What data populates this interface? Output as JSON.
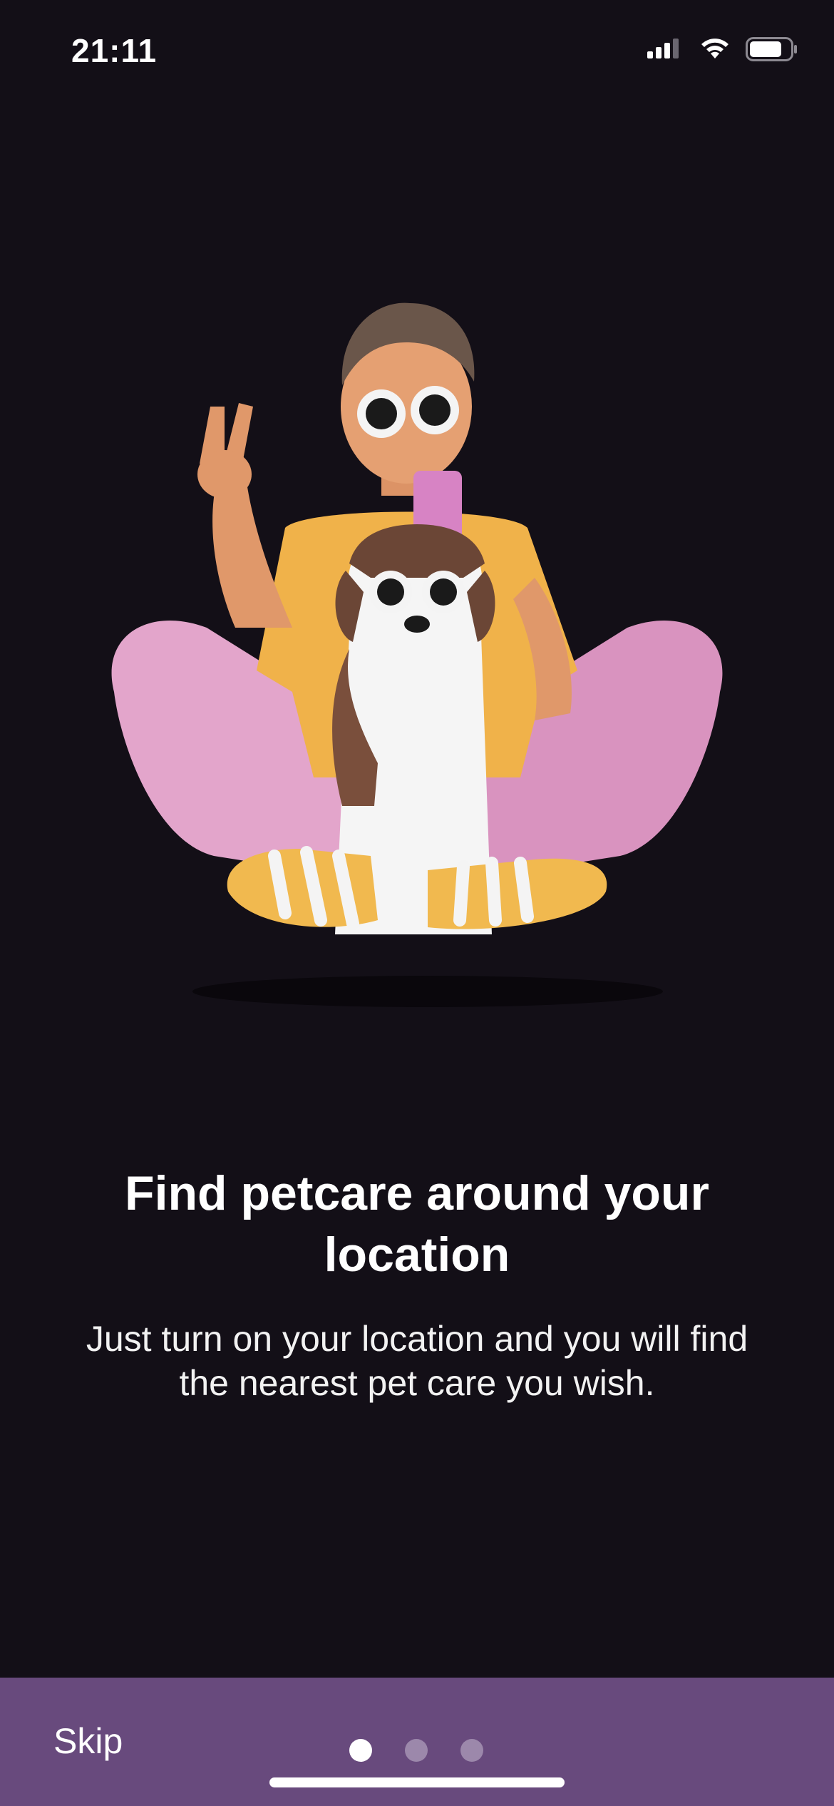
{
  "status_bar": {
    "time": "21:11",
    "icons": [
      "cellular-signal-icon",
      "wifi-icon",
      "battery-icon"
    ]
  },
  "illustration": {
    "subject": "person-with-dog-illustration"
  },
  "onboarding": {
    "title": "Find petcare around your location",
    "description": "Just turn on your location and you will find the nearest pet care you wish."
  },
  "bottom_bar": {
    "skip_label": "Skip",
    "page_count": 3,
    "active_page": 1
  },
  "colors": {
    "background": "#130f17",
    "bottom_bar": "#684a7d",
    "dot_active": "#ffffff",
    "dot_inactive": "#9c88ab"
  }
}
